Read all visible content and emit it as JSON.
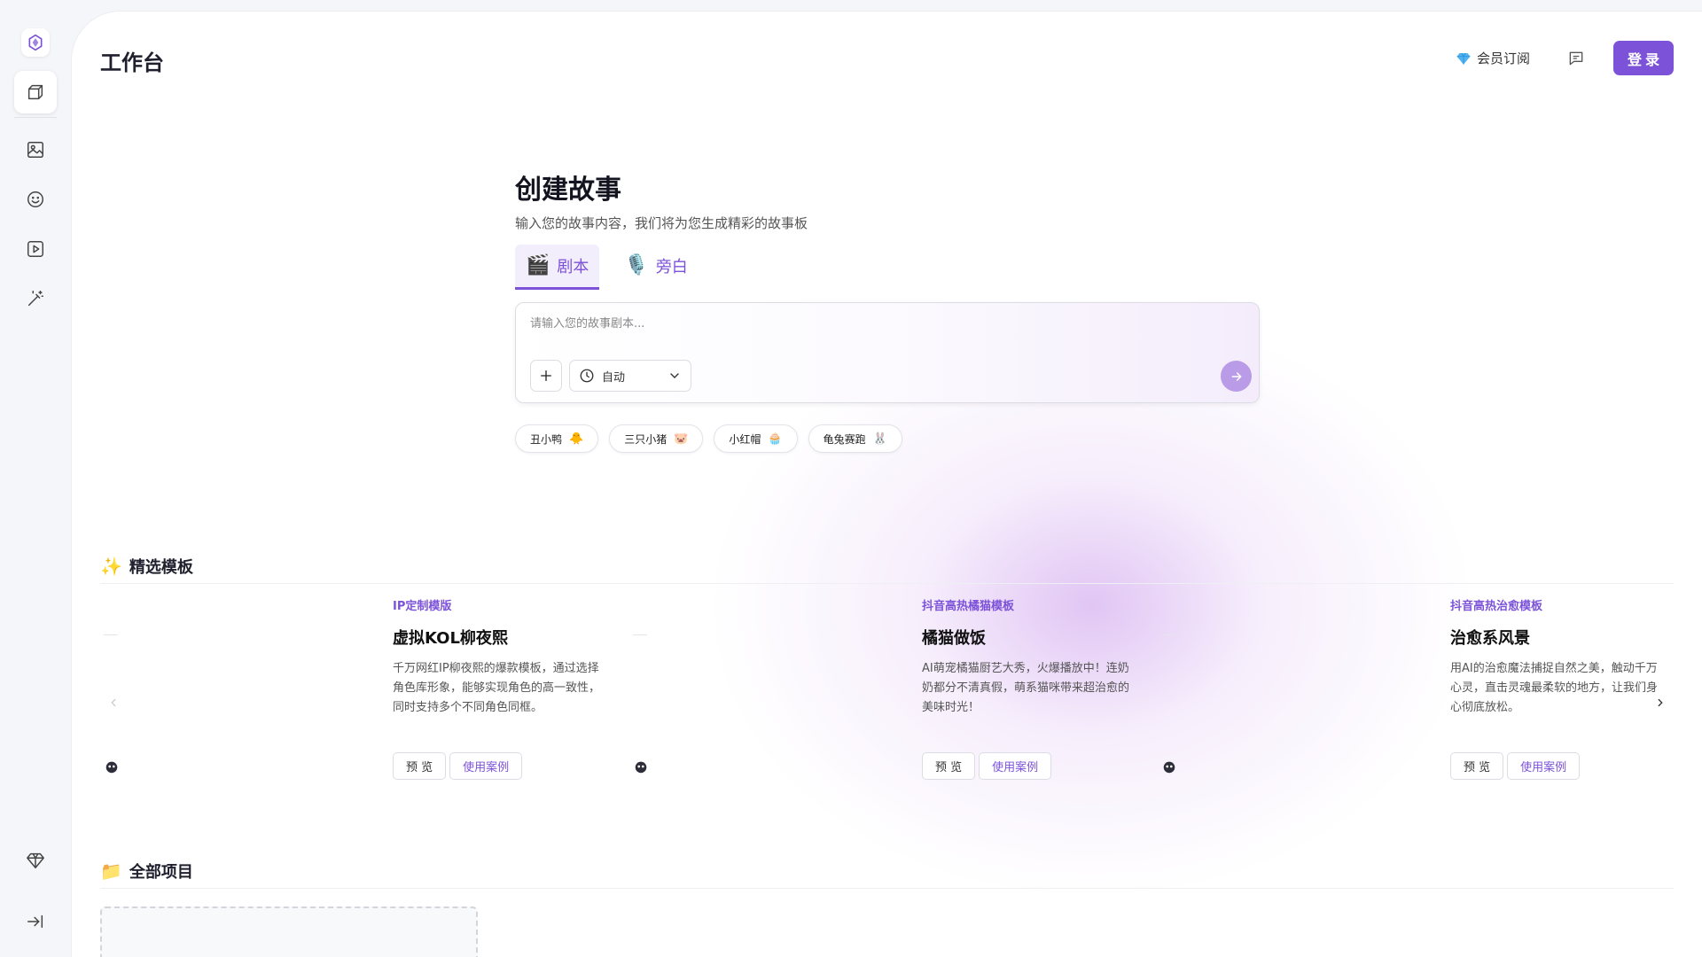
{
  "header": {
    "title": "工作台",
    "membership_label": "会员订阅",
    "login_label": "登录"
  },
  "create": {
    "title": "创建故事",
    "subtitle": "输入您的故事内容，我们将为您生成精彩的故事板",
    "tabs": [
      {
        "label": "剧本",
        "emoji": "🎬",
        "active": true
      },
      {
        "label": "旁白",
        "emoji": "🎙️",
        "active": false
      }
    ],
    "input": {
      "placeholder": "请输入您的故事剧本...",
      "value": ""
    },
    "mode_select": {
      "value": "自动"
    },
    "chips": [
      {
        "label": "丑小鸭",
        "emoji": "🐥"
      },
      {
        "label": "三只小猪",
        "emoji": "🐷"
      },
      {
        "label": "小红帽",
        "emoji": "🧁"
      },
      {
        "label": "龟兔赛跑",
        "emoji": "🐰"
      }
    ]
  },
  "templates": {
    "section_title": "精选模板",
    "section_emoji": "✨",
    "preview_label": "预 览",
    "case_label": "使用案例",
    "items": [
      {
        "tag": "IP定制模版",
        "title": "虚拟KOL柳夜熙",
        "description": "千万网红IP柳夜熙的爆款模板，通过选择角色库形象，能够实现角色的高一致性，同时支持多个不同角色同框。"
      },
      {
        "tag": "抖音高热橘猫模板",
        "title": "橘猫做饭",
        "description": "AI萌宠橘猫厨艺大秀，火爆播放中！连奶奶都分不清真假，萌系猫咪带来超治愈的美味时光！"
      },
      {
        "tag": "抖音高热治愈模板",
        "title": "治愈系风景",
        "description": "用AI的治愈魔法捕捉自然之美，触动千万心灵，直击灵魂最柔软的地方，让我们身心彻底放松。"
      }
    ]
  },
  "projects": {
    "section_title": "全部项目",
    "section_emoji": "📁"
  },
  "colors": {
    "accent": "#7c52d9",
    "send_button": "#b99be8",
    "diamond": "#4fb3f0"
  },
  "icons": {
    "rail": [
      "logo-icon",
      "cube-icon",
      "image-icon",
      "smiley-icon",
      "play-icon",
      "magic-wand-icon",
      "diamond-icon",
      "collapse-sidebar-icon"
    ],
    "header": [
      "diamond-icon",
      "message-icon"
    ],
    "editor": [
      "plus-icon",
      "clock-icon",
      "chevron-down-icon",
      "arrow-right-icon"
    ],
    "carousel": [
      "chevron-left-icon",
      "chevron-right-icon"
    ]
  }
}
